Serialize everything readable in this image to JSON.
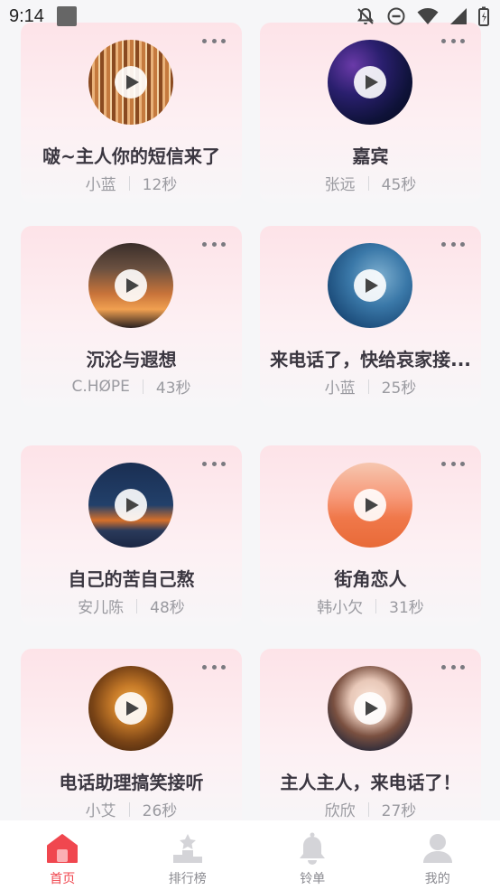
{
  "status_bar": {
    "time": "9:14"
  },
  "cards": [
    {
      "title": "啵~主人你的短信来了",
      "artist": "小蓝",
      "duration": "12秒"
    },
    {
      "title": "嘉宾",
      "artist": "张远",
      "duration": "45秒"
    },
    {
      "title": "沉沦与遐想",
      "artist": "C.HØPE",
      "duration": "43秒"
    },
    {
      "title": "来电话了，快给哀家接...",
      "artist": "小蓝",
      "duration": "25秒"
    },
    {
      "title": "自己的苦自己熬",
      "artist": "安儿陈",
      "duration": "48秒"
    },
    {
      "title": "街角恋人",
      "artist": "韩小欠",
      "duration": "31秒"
    },
    {
      "title": "电话助理搞笑接听",
      "artist": "小艾",
      "duration": "26秒"
    },
    {
      "title": "主人主人，来电话了！",
      "artist": "欣欣",
      "duration": "27秒"
    }
  ],
  "nav": [
    {
      "label": "首页",
      "icon": "home-icon",
      "active": true
    },
    {
      "label": "排行榜",
      "icon": "ranking-icon",
      "active": false
    },
    {
      "label": "铃单",
      "icon": "bell-icon",
      "active": false
    },
    {
      "label": "我的",
      "icon": "user-icon",
      "active": false
    }
  ],
  "colors": {
    "accent": "#f0474f",
    "card_top": "#fde3e8",
    "background": "#f6f6f8"
  }
}
